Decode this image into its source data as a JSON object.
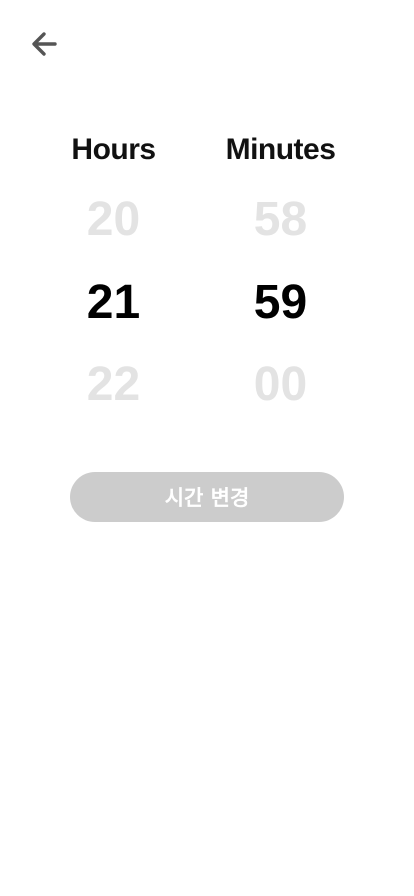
{
  "header": {
    "back_icon": "arrow-left-icon"
  },
  "picker": {
    "hours": {
      "label": "Hours",
      "prev": "20",
      "selected": "21",
      "next": "22"
    },
    "minutes": {
      "label": "Minutes",
      "prev": "58",
      "selected": "59",
      "next": "00"
    }
  },
  "actions": {
    "submit_label": "시간 변경",
    "submit_bg": "#cccccc",
    "submit_text_color": "#ffffff"
  },
  "colors": {
    "selected_text": "#000000",
    "faded_text": "#e3e3e3",
    "icon": "#555555"
  }
}
